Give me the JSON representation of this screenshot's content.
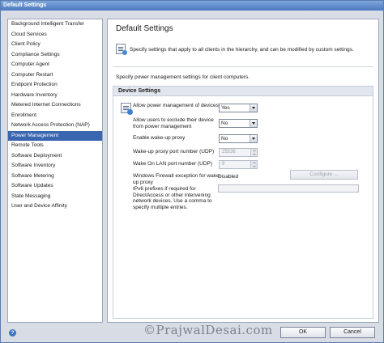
{
  "window": {
    "title": "Default Settings"
  },
  "nav": {
    "items": [
      "Background Intelligent Transfer",
      "Cloud Services",
      "Client Policy",
      "Compliance Settings",
      "Computer Agent",
      "Computer Restart",
      "Endpoint Protection",
      "Hardware Inventory",
      "Metered Internet Connections",
      "Enrollment",
      "Network Access Protection (NAP)",
      "Power Management",
      "Remote Tools",
      "Software Deployment",
      "Software Inventory",
      "Software Metering",
      "Software Updates",
      "State Messaging",
      "User and Device Affinity"
    ],
    "selected": "Power Management"
  },
  "content": {
    "title": "Default Settings",
    "description": "Specify settings that apply to all clients in the hierarchy, and can be modified by custom settings.",
    "power_text": "Specify power management settings for client computers.",
    "group_title": "Device Settings",
    "settings": {
      "allow_power": {
        "label": "Allow power management of devices",
        "value": "Yes"
      },
      "allow_exclude": {
        "label": "Allow users to exclude their device from power management",
        "value": "No"
      },
      "wake_proxy": {
        "label": "Enable wake-up proxy",
        "value": "No"
      },
      "proxy_port": {
        "label": "Wake-up proxy port number (UDP)",
        "value": "25536"
      },
      "lan_port": {
        "label": "Wake On LAN port number (UDP)",
        "value": "9"
      },
      "firewall": {
        "label": "Windows Firewall exception for wake-up proxy",
        "value": "Disabled",
        "button": "Configure ..."
      },
      "ipv6": {
        "label": "IPv6 prefixes if required for DirectAccess or other intervening network devices. Use a comma to specify multiple entries.",
        "value": ""
      }
    }
  },
  "footer": {
    "help_glyph": "?",
    "ok": "OK",
    "cancel": "Cancel"
  },
  "watermark": "©PrajwalDesai.com"
}
